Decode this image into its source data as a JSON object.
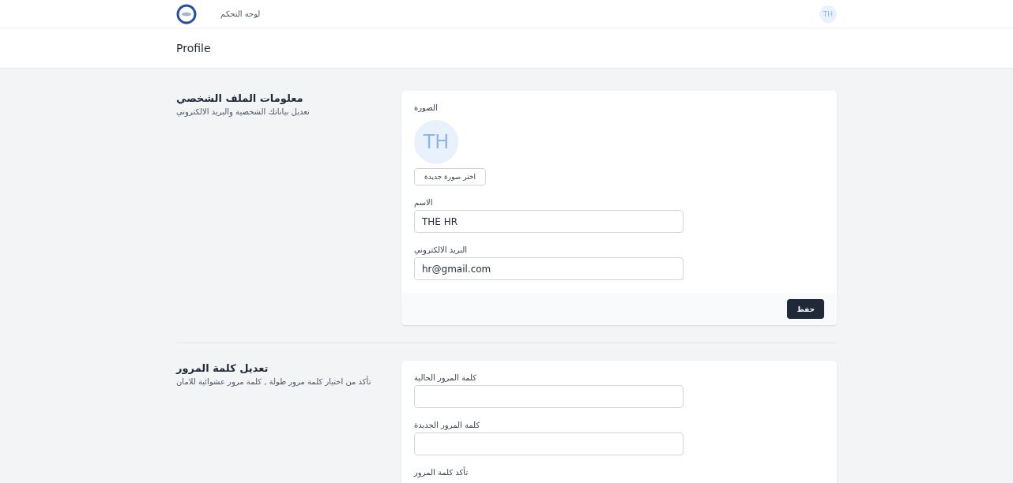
{
  "nav": {
    "link": "لوحة التحكم",
    "avatar_initials": "TH"
  },
  "page_header": {
    "title": "Profile"
  },
  "sections": [
    {
      "title": "معلومات الملف الشخصي",
      "description": "تعديل بياناتك الشخصية والبريد الالكتروني",
      "photo": {
        "label": "الصورة",
        "initials": "TH",
        "button": "اختر صورة جديدة"
      },
      "fields": [
        {
          "label": "الاسم",
          "kind": "input",
          "value": "THE HR"
        },
        {
          "label": "البريد الالكتروني",
          "kind": "input",
          "value": "hr@gmail.com"
        }
      ],
      "save_button": "حفظ"
    },
    {
      "title": "تعديل كلمة المرور",
      "description": "تأكد من اختيار كلمة مرور طولة , كلمة مرور عشوائية للامان",
      "fields": [
        {
          "label": "كلمة المرور الحالية",
          "kind": "input"
        },
        {
          "label": "كلمة المرور الجديدة",
          "kind": "input"
        },
        {
          "label": "تأكد كلمة المرور",
          "kind": "label"
        }
      ]
    }
  ]
}
